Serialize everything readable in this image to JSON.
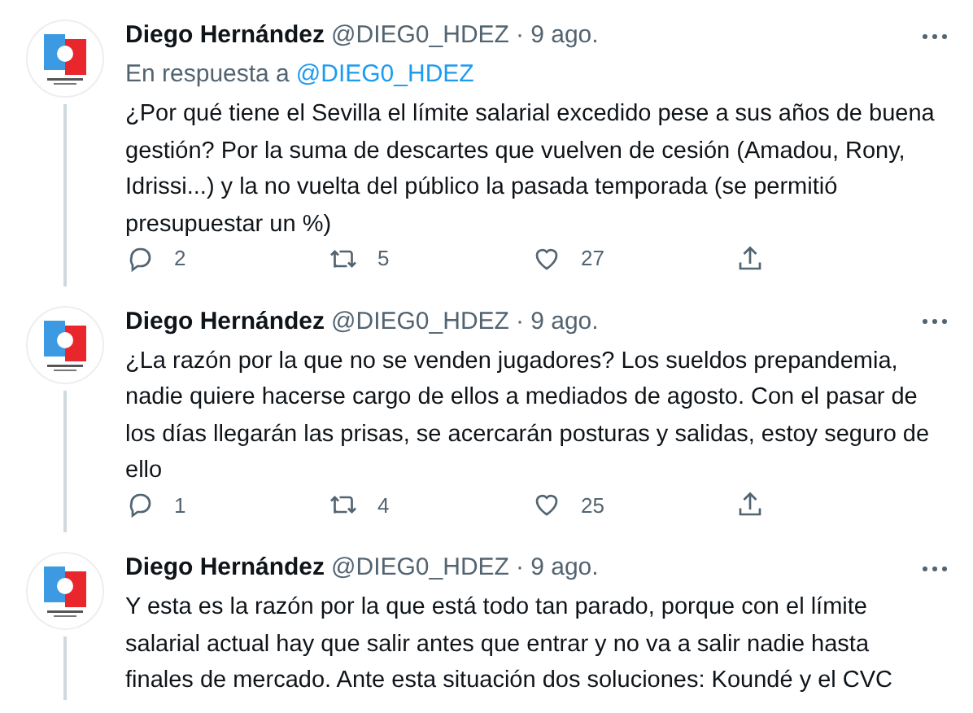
{
  "tweets": [
    {
      "name": "Diego Hernández",
      "handle": "@DIEG0_HDEZ",
      "date": "· 9 ago.",
      "reply_prefix": "En respuesta a",
      "reply_to": "@DIEG0_HDEZ",
      "text": "¿Por qué tiene el Sevilla el límite salarial excedido pese a sus años de buena gestión? Por la suma de descartes que vuelven de cesión (Amadou, Rony, Idrissi...) y la no vuelta del público la pasada temporada (se permitió presupuestar un %)",
      "replies": "2",
      "retweets": "5",
      "likes": "27"
    },
    {
      "name": "Diego Hernández",
      "handle": "@DIEG0_HDEZ",
      "date": "· 9 ago.",
      "text": "¿La razón por la que no se venden jugadores? Los sueldos prepandemia, nadie quiere hacerse cargo de ellos a mediados de agosto. Con el pasar de los días llegarán las prisas, se acercarán posturas y salidas, estoy seguro de ello",
      "replies": "1",
      "retweets": "4",
      "likes": "25"
    },
    {
      "name": "Diego Hernández",
      "handle": "@DIEG0_HDEZ",
      "date": "· 9 ago.",
      "text": "Y esta es la razón por la que está todo tan parado, porque con el límite salarial actual hay que salir antes que entrar y no va a salir nadie hasta finales de mercado. Ante esta situación dos soluciones: Koundé y el CVC"
    }
  ]
}
